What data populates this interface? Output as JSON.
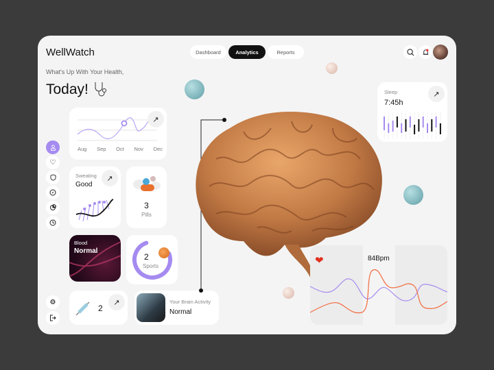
{
  "app": {
    "title": "WellWatch"
  },
  "nav": {
    "tabs": [
      {
        "label": "Dashboard",
        "active": false
      },
      {
        "label": "Analytics",
        "active": true
      },
      {
        "label": "Reports",
        "active": false
      }
    ]
  },
  "header": {
    "greeting": "What's Up With Your Health,",
    "title": "Today!"
  },
  "trend": {
    "months": [
      "Aug",
      "Sep",
      "Oct",
      "Nov",
      "Dec"
    ],
    "highlight": "Oct"
  },
  "sweating": {
    "label": "Sweating",
    "value": "Good"
  },
  "pills": {
    "count": "3",
    "label": "Pills"
  },
  "blood": {
    "label": "Blood",
    "value": "Normal"
  },
  "sports": {
    "count": "2",
    "label": "Sports",
    "progress": 0.75
  },
  "injections": {
    "count": "2"
  },
  "brain": {
    "label": "Your Brain Activity",
    "value": "Normal"
  },
  "sleep": {
    "label": "Sleep",
    "value": "7:45h"
  },
  "heart": {
    "value": "84Bpm"
  },
  "colors": {
    "accent": "#a58bf0",
    "dark": "#111111",
    "heart_line": "#f26a3d",
    "wave_line": "#a58bf0"
  },
  "sidebar": {
    "icons": [
      "user-icon",
      "heart-icon",
      "shield-icon",
      "compass-icon",
      "pie-chart-icon",
      "clock-icon"
    ],
    "bottom": [
      "settings-icon",
      "logout-icon"
    ]
  }
}
